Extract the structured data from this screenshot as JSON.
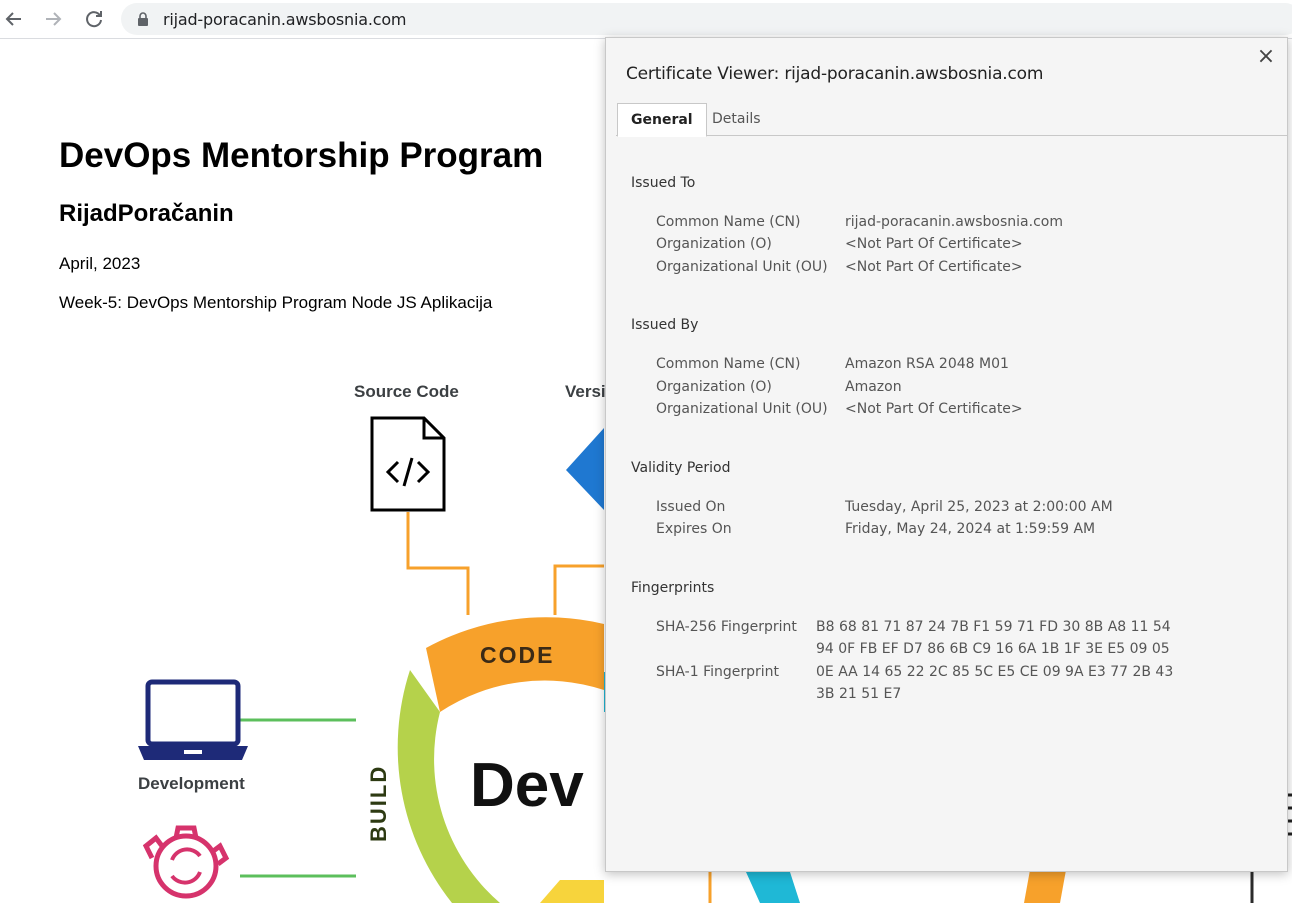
{
  "browser": {
    "url": "rijad-poracanin.awsbosnia.com"
  },
  "page": {
    "title": "DevOps Mentorship Program",
    "author": "RijadPoračanin",
    "date": "April, 2023",
    "subtitle": "Week-5: DevOps Mentorship Program Node JS Aplikacija",
    "diagram": {
      "source_code_label": "Source Code",
      "version_label_partial": "Versi",
      "code_label": "CODE",
      "build_label": "BUILD",
      "dev_label": "Dev",
      "development_label": "Development"
    },
    "colors": {
      "orange": "#f7a12b",
      "green": "#b5d24b",
      "blue": "#1f78d1",
      "navy": "#1e2a78",
      "crimson": "#d6336c",
      "line_green": "#5cbf5c"
    }
  },
  "dialog": {
    "title": "Certificate Viewer: rijad-poracanin.awsbosnia.com",
    "close_label": "×",
    "tabs": [
      "General",
      "Details"
    ],
    "issued_to": {
      "heading": "Issued To",
      "rows": [
        {
          "label": "Common Name (CN)",
          "value": "rijad-poracanin.awsbosnia.com"
        },
        {
          "label": "Organization (O)",
          "value": "<Not Part Of Certificate>"
        },
        {
          "label": "Organizational Unit (OU)",
          "value": "<Not Part Of Certificate>"
        }
      ]
    },
    "issued_by": {
      "heading": "Issued By",
      "rows": [
        {
          "label": "Common Name (CN)",
          "value": "Amazon RSA 2048 M01"
        },
        {
          "label": "Organization (O)",
          "value": "Amazon"
        },
        {
          "label": "Organizational Unit (OU)",
          "value": "<Not Part Of Certificate>"
        }
      ]
    },
    "validity": {
      "heading": "Validity Period",
      "rows": [
        {
          "label": "Issued On",
          "value": "Tuesday, April 25, 2023 at 2:00:00 AM"
        },
        {
          "label": "Expires On",
          "value": "Friday, May 24, 2024 at 1:59:59 AM"
        }
      ]
    },
    "fingerprints": {
      "heading": "Fingerprints",
      "rows": [
        {
          "label": "SHA-256 Fingerprint",
          "line1": "B8 68 81 71 87 24 7B F1 59 71 FD 30 8B A8 11 54",
          "line2": "94 0F FB EF D7 86 6B C9 16 6A 1B 1F 3E E5 09 05"
        },
        {
          "label": "SHA-1 Fingerprint",
          "line1": "0E AA 14 65 22 2C 85 5C E5 CE 09 9A E3 77 2B 43",
          "line2": "3B 21 51 E7"
        }
      ]
    }
  }
}
